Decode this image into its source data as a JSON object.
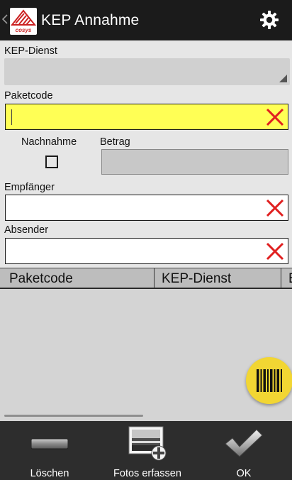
{
  "header": {
    "title": "KEP Annahme",
    "logo_text": "cosys",
    "logo_colors": {
      "accent": "#cc2222",
      "text": "#cc2222"
    },
    "icons": {
      "back": "chevron-left-icon",
      "settings": "gear-icon"
    }
  },
  "form": {
    "kep_dienst": {
      "label": "KEP-Dienst",
      "value": ""
    },
    "paketcode": {
      "label": "Paketcode",
      "value": ""
    },
    "nachnahme": {
      "label": "Nachnahme",
      "checked": false
    },
    "betrag": {
      "label": "Betrag",
      "value": ""
    },
    "empfaenger": {
      "label": "Empfänger",
      "value": ""
    },
    "absender": {
      "label": "Absender",
      "value": ""
    }
  },
  "table": {
    "columns": [
      "Paketcode",
      "KEP-Dienst",
      "B"
    ],
    "rows": []
  },
  "fab": {
    "icon": "barcode-icon"
  },
  "bottom_bar": {
    "delete_label": "Löschen",
    "photos_label": "Fotos erfassen",
    "ok_label": "OK"
  },
  "colors": {
    "active_field": "#ffff55",
    "clear_icon": "#e02020",
    "fab": "#f2d633",
    "header": "#1b1b1b"
  }
}
